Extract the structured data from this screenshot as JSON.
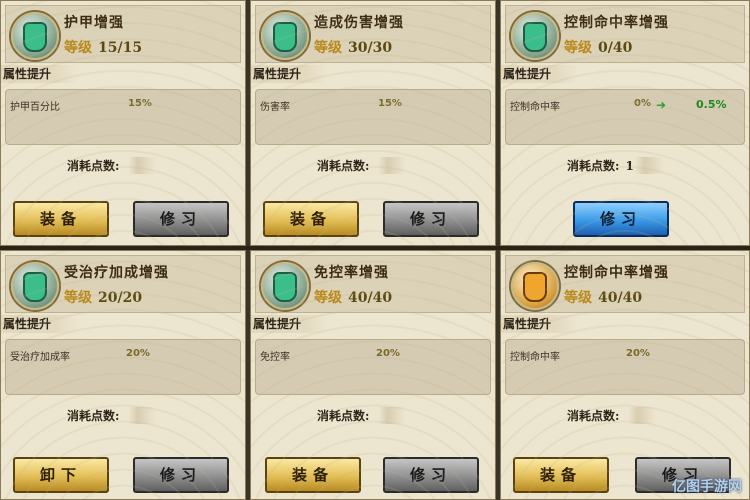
{
  "panels": [
    {
      "title": "护甲增强",
      "level_label": "等级",
      "level": "15/15",
      "attr_section": "属性提升",
      "attr_name": "护甲百分比",
      "attr_value": "15%",
      "cost_label": "消耗点数:",
      "cost_value": "",
      "btn1": "装备",
      "btn2": "修习",
      "icon": "shield-icon",
      "btn2_style": "gray"
    },
    {
      "title": "造成伤害增强",
      "level_label": "等级",
      "level": "30/30",
      "attr_section": "属性提升",
      "attr_name": "伤害率",
      "attr_value": "15%",
      "cost_label": "消耗点数:",
      "cost_value": "",
      "btn1": "装备",
      "btn2": "修习",
      "icon": "flame-icon",
      "btn2_style": "gray"
    },
    {
      "title": "控制命中率增强",
      "level_label": "等级",
      "level": "0/40",
      "attr_section": "属性提升",
      "attr_name": "控制命中率",
      "attr_value": "0%",
      "attr_next": "0.5%",
      "cost_label": "消耗点数:",
      "cost_value": "1",
      "btn2": "修习",
      "icon": "figure-icon",
      "btn2_style": "blue"
    },
    {
      "title": "受治疗加成增强",
      "level_label": "等级",
      "level": "20/20",
      "attr_section": "属性提升",
      "attr_name": "受治疗加成率",
      "attr_value": "20%",
      "cost_label": "消耗点数:",
      "cost_value": "",
      "btn1": "卸下",
      "btn2": "修习",
      "icon": "heal-icon",
      "btn2_style": "gray"
    },
    {
      "title": "免控率增强",
      "level_label": "等级",
      "level": "40/40",
      "attr_section": "属性提升",
      "attr_name": "免控率",
      "attr_value": "20%",
      "cost_label": "消耗点数:",
      "cost_value": "",
      "btn1": "装备",
      "btn2": "修习",
      "icon": "ward-icon",
      "btn2_style": "gray"
    },
    {
      "title": "控制命中率增强",
      "level_label": "等级",
      "level": "40/40",
      "attr_section": "属性提升",
      "attr_name": "控制命中率",
      "attr_value": "20%",
      "cost_label": "消耗点数:",
      "cost_value": "",
      "btn1": "装备",
      "btn2": "修习",
      "icon": "figure-gold-icon",
      "btn2_style": "gray"
    }
  ],
  "watermark": "亿图手游网"
}
